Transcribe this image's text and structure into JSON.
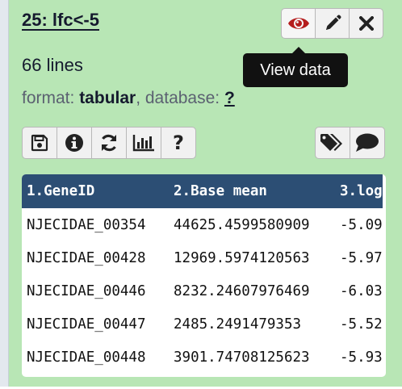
{
  "dataset": {
    "title": "25: lfc<-5",
    "lines": "66 lines",
    "format_label": "format: ",
    "format_value": "tabular",
    "database_label": ", database: ",
    "database_value": "?"
  },
  "tooltip": {
    "text": "View data"
  },
  "top_buttons": [
    {
      "icon": "eye-icon",
      "color": "#b51d1d"
    },
    {
      "icon": "pencil-icon"
    },
    {
      "icon": "close-icon"
    }
  ],
  "action_buttons": [
    {
      "icon": "save-icon"
    },
    {
      "icon": "info-icon"
    },
    {
      "icon": "rerun-icon"
    },
    {
      "icon": "chart-icon"
    },
    {
      "icon": "help-icon",
      "text": "?"
    }
  ],
  "right_buttons": [
    {
      "icon": "tags-icon"
    },
    {
      "icon": "comment-icon"
    }
  ],
  "table": {
    "headers": [
      "1.GeneID",
      "2.Base mean",
      "3.log"
    ],
    "rows": [
      [
        "NJECIDAE_00354",
        "44625.4599580909",
        "-5.09"
      ],
      [
        "NJECIDAE_00428",
        "12969.5974120563",
        "-5.97"
      ],
      [
        "NJECIDAE_00446",
        "8232.24607976469",
        "-6.03"
      ],
      [
        "NJECIDAE_00447",
        "2485.2491479353",
        "-5.52"
      ],
      [
        "NJECIDAE_00448",
        "3901.74708125623",
        "-5.93"
      ]
    ]
  },
  "colors": {
    "panel_bg": "#b8e6b5",
    "table_header_bg": "#2c4e74",
    "eye_icon": "#b51d1d"
  }
}
